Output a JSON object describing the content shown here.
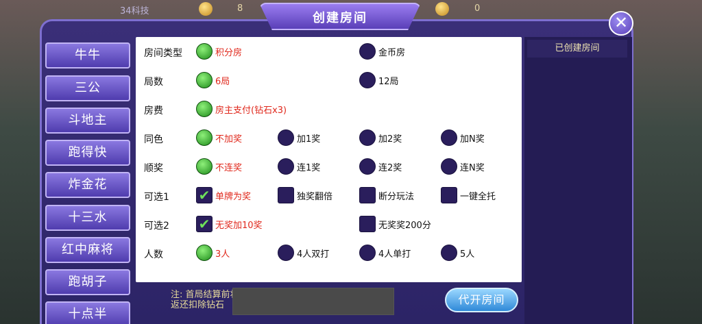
{
  "topbar": {
    "player_id": "34科技",
    "coins": "8",
    "gold": "0"
  },
  "dialog": {
    "title": "创建房间",
    "close": "✕"
  },
  "games": [
    "牛牛",
    "三公",
    "斗地主",
    "跑得快",
    "炸金花",
    "十三水",
    "红中麻将",
    "跑胡子",
    "十点半"
  ],
  "rows": [
    {
      "label": "房间类型",
      "options": [
        {
          "text": "积分房",
          "type": "radio",
          "selected": true
        },
        {
          "text": "金币房",
          "type": "radio",
          "selected": false
        }
      ]
    },
    {
      "label": "局数",
      "options": [
        {
          "text": "6局",
          "type": "radio",
          "selected": true
        },
        {
          "text": "12局",
          "type": "radio",
          "selected": false
        }
      ]
    },
    {
      "label": "房费",
      "options": [
        {
          "text": "房主支付(钻石x3)",
          "type": "radio",
          "selected": true
        }
      ]
    },
    {
      "label": "同色",
      "options": [
        {
          "text": "不加奖",
          "type": "radio",
          "selected": true
        },
        {
          "text": "加1奖",
          "type": "radio",
          "selected": false
        },
        {
          "text": "加2奖",
          "type": "radio",
          "selected": false
        },
        {
          "text": "加N奖",
          "type": "radio",
          "selected": false
        }
      ]
    },
    {
      "label": "顺奖",
      "options": [
        {
          "text": "不连奖",
          "type": "radio",
          "selected": true
        },
        {
          "text": "连1奖",
          "type": "radio",
          "selected": false
        },
        {
          "text": "连2奖",
          "type": "radio",
          "selected": false
        },
        {
          "text": "连N奖",
          "type": "radio",
          "selected": false
        }
      ]
    },
    {
      "label": "可选1",
      "options": [
        {
          "text": "单牌为奖",
          "type": "check",
          "selected": true
        },
        {
          "text": "独奖翻倍",
          "type": "check",
          "selected": false
        },
        {
          "text": "断分玩法",
          "type": "check",
          "selected": false
        },
        {
          "text": "一键全托",
          "type": "check",
          "selected": false
        }
      ]
    },
    {
      "label": "可选2",
      "options": [
        {
          "text": "无奖加10奖",
          "type": "check",
          "selected": true
        },
        {
          "text": "无奖奖200分",
          "type": "check",
          "selected": false
        }
      ]
    },
    {
      "label": "人数",
      "options": [
        {
          "text": "3人",
          "type": "radio",
          "selected": true
        },
        {
          "text": "4人双打",
          "type": "radio",
          "selected": false
        },
        {
          "text": "4人单打",
          "type": "radio",
          "selected": false
        },
        {
          "text": "5人",
          "type": "radio",
          "selected": false
        }
      ]
    }
  ],
  "created_rooms": {
    "header": "已创建房间"
  },
  "note": {
    "line1": "注: 首局结算前将",
    "line2": "返还扣除钻石"
  },
  "open_button": "代开房间",
  "colors": {
    "selected_text": "#e0281c",
    "panel": "#2c2466",
    "radio_on": "#1d8a1a",
    "radio_off": "#2a1e5c"
  }
}
